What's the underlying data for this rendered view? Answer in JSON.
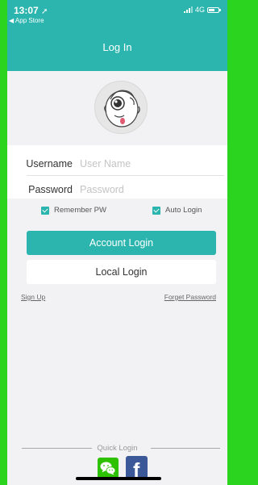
{
  "status_bar": {
    "time": "13:07",
    "back_label": "◀ App Store",
    "network": "4G"
  },
  "header": {
    "title": "Log In"
  },
  "form": {
    "username_label": "Username",
    "username_placeholder": "User Name",
    "username_value": "",
    "password_label": "Password",
    "password_placeholder": "Password",
    "password_value": ""
  },
  "options": {
    "remember_label": "Remember PW",
    "remember_checked": true,
    "autologin_label": "Auto Login",
    "autologin_checked": true
  },
  "buttons": {
    "account_login": "Account Login",
    "local_login": "Local Login"
  },
  "links": {
    "sign_up": "Sign Up",
    "forget_password": "Forget Password"
  },
  "quick_login": {
    "label": "Quick Login",
    "providers": [
      "wechat-icon",
      "facebook-icon"
    ]
  },
  "colors": {
    "accent": "#2bb5ae",
    "frame": "#2bd41f",
    "background": "#f2f2f4",
    "wechat": "#2dc100",
    "facebook": "#3b5998"
  }
}
